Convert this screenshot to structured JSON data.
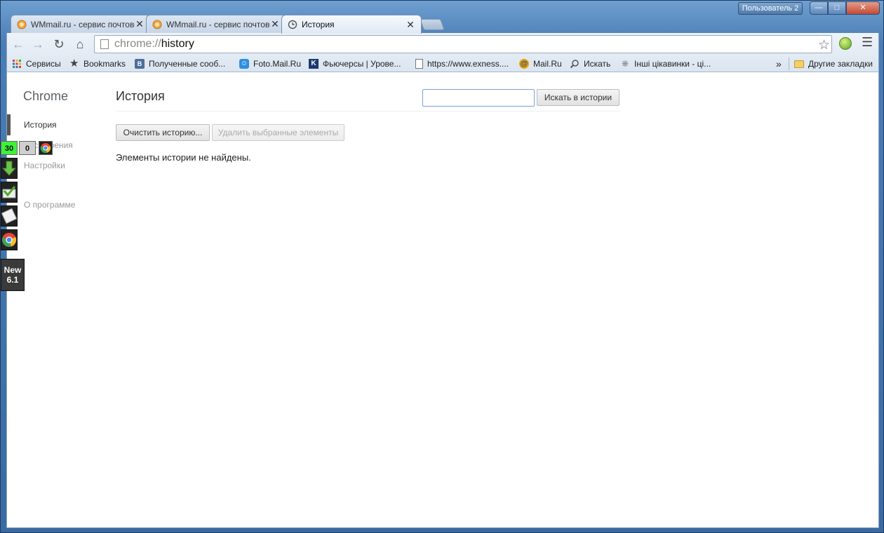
{
  "window": {
    "profile_label": "Пользователь 2"
  },
  "tabs": [
    {
      "title": "WMmail.ru - сервис почтового",
      "active": false
    },
    {
      "title": "WMmail.ru - сервис почтового",
      "active": false
    },
    {
      "title": "История",
      "active": true
    }
  ],
  "omnibox": {
    "scheme": "chrome://",
    "host": "history"
  },
  "bookmarks": [
    {
      "label": "Сервисы",
      "icon": "apps-grid-icon"
    },
    {
      "label": "Bookmarks",
      "icon": "star-icon"
    },
    {
      "label": "Полученные сооб...",
      "icon": "vk-icon"
    },
    {
      "label": "Foto.Mail.Ru",
      "icon": "smile-icon"
    },
    {
      "label": "Фьючерсы | Урове...",
      "icon": "k-logo-icon"
    },
    {
      "label": "https://www.exness....",
      "icon": "page-icon"
    },
    {
      "label": "Mail.Ru",
      "icon": "mail-at-icon"
    },
    {
      "label": "Искать",
      "icon": "search-icon"
    },
    {
      "label": "Інші цікавинки - ці...",
      "icon": "bug-icon"
    }
  ],
  "bookmarks_overflow": "»",
  "other_bookmarks": "Другие закладки",
  "sidebar": {
    "title": "Chrome",
    "items": [
      {
        "label": "История",
        "selected": true
      },
      {
        "label": "Расширения",
        "selected": false
      },
      {
        "label": "Настройки",
        "selected": false
      },
      {
        "label": "О программе",
        "selected": false
      }
    ]
  },
  "main": {
    "title": "История",
    "search_button": "Искать в истории",
    "search_value": "",
    "clear_button": "Очистить историю...",
    "delete_button": "Удалить выбранные элементы",
    "empty_message": "Элементы истории не найдены."
  },
  "widget": {
    "counter_green": "30",
    "counter_gray": "0",
    "new_badge_line1": "New",
    "new_badge_line2": "6.1"
  }
}
